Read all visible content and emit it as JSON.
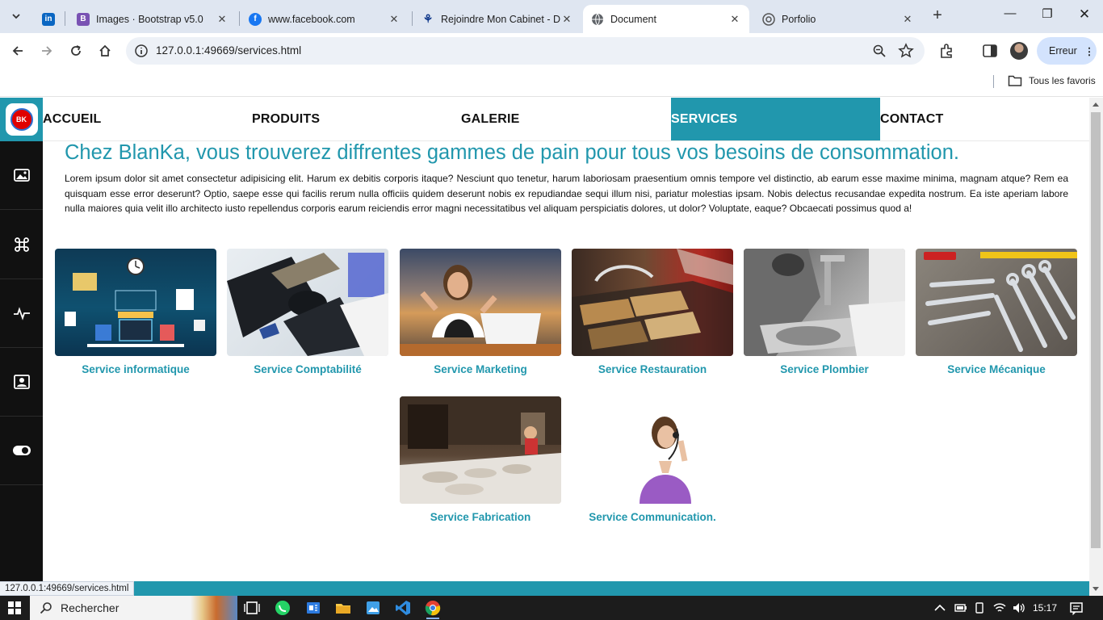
{
  "browser": {
    "tabs": [
      {
        "title": "",
        "icon": "linkedin-icon",
        "color": "#0a66c2"
      },
      {
        "title": "Images · Bootstrap v5.0",
        "icon": "bootstrap-icon",
        "color": "#7952b3"
      },
      {
        "title": "www.facebook.com",
        "icon": "facebook-icon",
        "color": "#1877f2"
      },
      {
        "title": "Rejoindre Mon Cabinet - D",
        "icon": "cabinet-icon",
        "color": "#123a8c"
      },
      {
        "title": "Document",
        "icon": "globe-icon",
        "color": "#555555"
      },
      {
        "title": "Porfolio",
        "icon": "portfolio-icon",
        "color": "#555555"
      }
    ],
    "url": "127.0.0.1:49669/services.html",
    "profile_button": "Erreur",
    "bookmarks_all": "Tous les favoris",
    "status_url": "127.0.0.1:49669/services.html"
  },
  "page": {
    "nav": [
      {
        "label": "ACCUEIL",
        "active": false
      },
      {
        "label": "PRODUITS",
        "active": false
      },
      {
        "label": "GALERIE",
        "active": false
      },
      {
        "label": "SERVICES",
        "active": true
      },
      {
        "label": "CONTACT",
        "active": false
      }
    ],
    "logo_text": "BK",
    "headline": "Chez BlanKa, vous trouverez diffrentes gammes de pain pour tous vos besoins de consommation.",
    "lead": "Lorem ipsum dolor sit amet consectetur adipisicing elit. Harum ex debitis corporis itaque? Nesciunt quo tenetur, harum laboriosam praesentium omnis tempore vel distinctio, ab earum esse maxime minima, magnam atque? Rem ea quisquam esse error deserunt? Optio, saepe esse qui facilis rerum nulla officiis quidem deserunt nobis ex repudiandae sequi illum nisi, pariatur molestias ipsam. Nobis delectus recusandae expedita nostrum. Ea iste aperiam labore nulla maiores quia velit illo architecto iusto repellendus corporis earum reiciendis error magni necessitatibus vel aliquam perspiciatis dolores, ut dolor? Voluptate, eaque? Obcaecati possimus quod a!",
    "services": [
      {
        "title": "Service informatique",
        "image": "it-development-illustration"
      },
      {
        "title": "Service Comptabilité",
        "image": "calculator-keyboard-photo"
      },
      {
        "title": "Service Marketing",
        "image": "businesswoman-laptop-photo"
      },
      {
        "title": "Service Restauration",
        "image": "buffet-food-photo"
      },
      {
        "title": "Service Plombier",
        "image": "plumber-sink-photo"
      },
      {
        "title": "Service Mécanique",
        "image": "wrenches-tools-photo"
      },
      {
        "title": "Service Fabrication",
        "image": "bakery-workshop-photo"
      },
      {
        "title": "Service Communication.",
        "image": "woman-headset-photo"
      }
    ],
    "accent_color": "#2197ad"
  },
  "taskbar": {
    "search_placeholder": "Rechercher",
    "time": "15:17"
  }
}
